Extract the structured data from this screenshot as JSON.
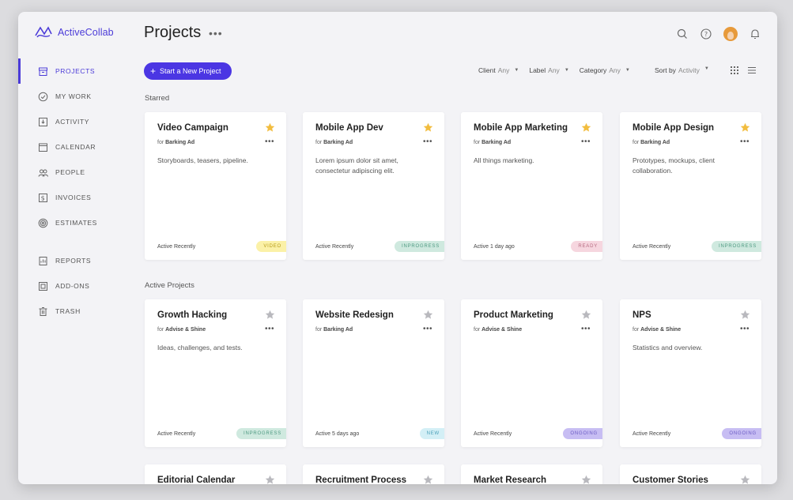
{
  "app": {
    "name": "ActiveCollab",
    "brand_color": "#4b3bd8"
  },
  "sidebar": {
    "items": [
      {
        "label": "PROJECTS",
        "icon": "projects-icon",
        "active": true
      },
      {
        "label": "MY WORK",
        "icon": "check-circle-icon"
      },
      {
        "label": "ACTIVITY",
        "icon": "activity-icon"
      },
      {
        "label": "CALENDAR",
        "icon": "calendar-icon"
      },
      {
        "label": "PEOPLE",
        "icon": "people-icon"
      },
      {
        "label": "INVOICES",
        "icon": "invoice-icon"
      },
      {
        "label": "ESTIMATES",
        "icon": "estimates-icon"
      }
    ],
    "items2": [
      {
        "label": "REPORTS",
        "icon": "reports-icon"
      },
      {
        "label": "ADD-ONS",
        "icon": "addons-icon"
      },
      {
        "label": "TRASH",
        "icon": "trash-icon"
      }
    ]
  },
  "header": {
    "title": "Projects",
    "more": "•••"
  },
  "toolbar": {
    "new_project": "Start a New Project",
    "filters": [
      {
        "label": "Client",
        "value": "Any"
      },
      {
        "label": "Label",
        "value": "Any"
      },
      {
        "label": "Category",
        "value": "Any"
      }
    ],
    "sort": {
      "label": "Sort by",
      "value": "Activity"
    }
  },
  "sections": {
    "starred": "Starred",
    "active": "Active Projects"
  },
  "starred_projects": [
    {
      "title": "Video Campaign",
      "for": "for",
      "client": "Barking Ad",
      "desc": "Storyboards, teasers, pipeline.",
      "activity": "Active Recently",
      "badge": "VIDEO",
      "badge_bg": "#fbf1a8",
      "badge_fg": "#b59a16"
    },
    {
      "title": "Mobile App Dev",
      "for": "for",
      "client": "Barking Ad",
      "desc": "Lorem ipsum dolor sit amet, consectetur adipiscing elit.",
      "activity": "Active Recently",
      "badge": "INPROGRESS",
      "badge_bg": "#cfe9df",
      "badge_fg": "#4e9a82"
    },
    {
      "title": "Mobile App Marketing",
      "for": "for",
      "client": "Barking Ad",
      "desc": "All things marketing.",
      "activity": "Active 1 day ago",
      "badge": "READY",
      "badge_bg": "#f6d6df",
      "badge_fg": "#b76a80"
    },
    {
      "title": "Mobile App Design",
      "for": "for",
      "client": "Barking Ad",
      "desc": "Prototypes, mockups, client collaboration.",
      "activity": "Active Recently",
      "badge": "INPROGRESS",
      "badge_bg": "#cfe9df",
      "badge_fg": "#4e9a82"
    }
  ],
  "active_projects": [
    {
      "title": "Growth Hacking",
      "for": "for",
      "client": "Advise & Shine",
      "desc": "Ideas, challenges, and tests.",
      "activity": "Active Recently",
      "badge": "INPROGRESS",
      "badge_bg": "#cfe9df",
      "badge_fg": "#4e9a82"
    },
    {
      "title": "Website Redesign",
      "for": "for",
      "client": "Barking Ad",
      "desc": "",
      "activity": "Active 5 days ago",
      "badge": "NEW",
      "badge_bg": "#d3eff6",
      "badge_fg": "#4a9fb8"
    },
    {
      "title": "Product Marketing",
      "for": "for",
      "client": "Advise & Shine",
      "desc": "",
      "activity": "Active Recently",
      "badge": "ONGOING",
      "badge_bg": "#c7bdf3",
      "badge_fg": "#6b5bc4"
    },
    {
      "title": "NPS",
      "for": "for",
      "client": "Advise & Shine",
      "desc": "Statistics and overview.",
      "activity": "Active Recently",
      "badge": "ONGOING",
      "badge_bg": "#c7bdf3",
      "badge_fg": "#6b5bc4"
    }
  ],
  "more_projects": [
    {
      "title": "Editorial Calendar"
    },
    {
      "title": "Recruitment Process"
    },
    {
      "title": "Market Research"
    },
    {
      "title": "Customer Stories"
    }
  ]
}
